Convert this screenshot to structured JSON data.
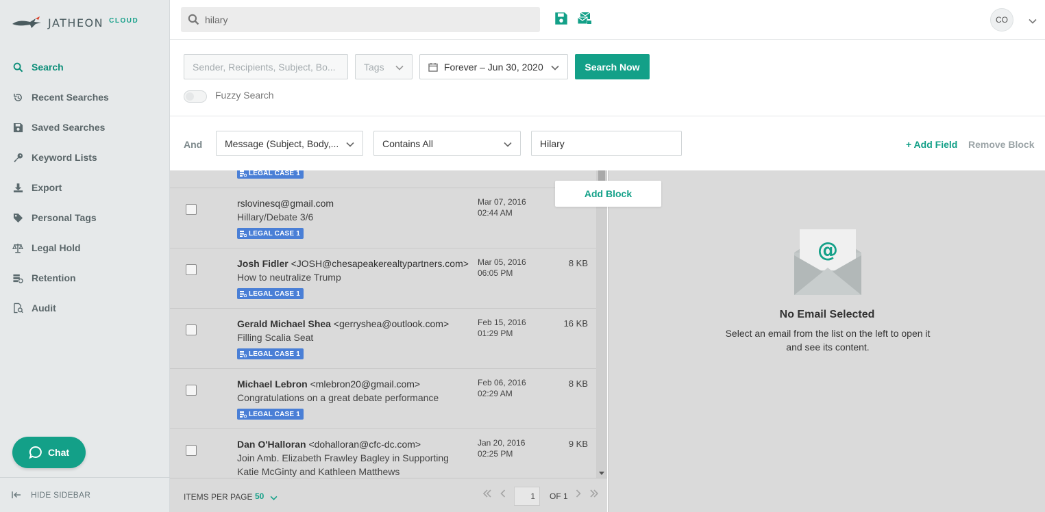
{
  "brand": {
    "name": "JATHEON",
    "suffix": "CLOUD"
  },
  "sidebar": {
    "items": [
      {
        "label": "Search",
        "icon": "search-icon",
        "active": true
      },
      {
        "label": "Recent Searches",
        "icon": "history-icon"
      },
      {
        "label": "Saved Searches",
        "icon": "save-icon"
      },
      {
        "label": "Keyword Lists",
        "icon": "key-icon"
      },
      {
        "label": "Export",
        "icon": "download-icon"
      },
      {
        "label": "Personal Tags",
        "icon": "tag-icon"
      },
      {
        "label": "Legal Hold",
        "icon": "scale-icon"
      },
      {
        "label": "Retention",
        "icon": "retention-icon"
      },
      {
        "label": "Audit",
        "icon": "audit-icon"
      }
    ],
    "chat_label": "Chat",
    "hide_label": "HIDE SIDEBAR"
  },
  "topbar": {
    "search_value": "hilary",
    "avatar": "CO"
  },
  "search": {
    "query_placeholder": "Sender, Recipients, Subject, Bo...",
    "tags_placeholder": "Tags",
    "date_range": "Forever – Jun 30, 2020",
    "search_button": "Search Now",
    "fuzzy_label": "Fuzzy Search"
  },
  "block": {
    "operator": "And",
    "field": "Message (Subject, Body,...",
    "condition": "Contains All",
    "value": "Hilary",
    "add_field": "+ Add Field",
    "remove_block": "Remove Block",
    "add_block": "Add Block"
  },
  "emails": [
    {
      "from_name": "",
      "from_email": "rslovinesq@gmail.com",
      "subject": "Hillary/Debate 3/6",
      "tag": "LEGAL CASE 1",
      "date": "Mar 07, 2016",
      "time": "02:44 AM",
      "size": ""
    },
    {
      "from_name": "Josh Fidler",
      "from_email": "<JOSH@chesapeakerealtypartners.com>",
      "subject": "How to neutralize Trump",
      "tag": "LEGAL CASE 1",
      "date": "Mar 05, 2016",
      "time": "06:05 PM",
      "size": "8 KB"
    },
    {
      "from_name": "Gerald Michael Shea",
      "from_email": "<gerryshea@outlook.com>",
      "subject": "Filling Scalia Seat",
      "tag": "LEGAL CASE 1",
      "date": "Feb 15, 2016",
      "time": "01:29 PM",
      "size": "16 KB"
    },
    {
      "from_name": "Michael Lebron",
      "from_email": "<mlebron20@gmail.com>",
      "subject": "Congratulations on a great debate performance",
      "tag": "LEGAL CASE 1",
      "date": "Feb 06, 2016",
      "time": "02:29 AM",
      "size": "8 KB"
    },
    {
      "from_name": "Dan O'Halloran",
      "from_email": "<dohalloran@cfc-dc.com>",
      "subject": "Join Amb. Elizabeth Frawley Bagley in Supporting Katie McGinty and Kathleen Matthews",
      "tag": "",
      "date": "Jan 20, 2016",
      "time": "02:25 PM",
      "size": "9 KB"
    }
  ],
  "partial_tag": "LEGAL CASE 1",
  "pager": {
    "items_per_page_label": "ITEMS PER PAGE",
    "items_per_page": "50",
    "page": "1",
    "of": "OF 1"
  },
  "preview": {
    "title": "No Email Selected",
    "message": "Select an email from the list on the left to open it and see its content."
  },
  "colors": {
    "accent": "#13a088",
    "tag": "#4a7fd6"
  }
}
